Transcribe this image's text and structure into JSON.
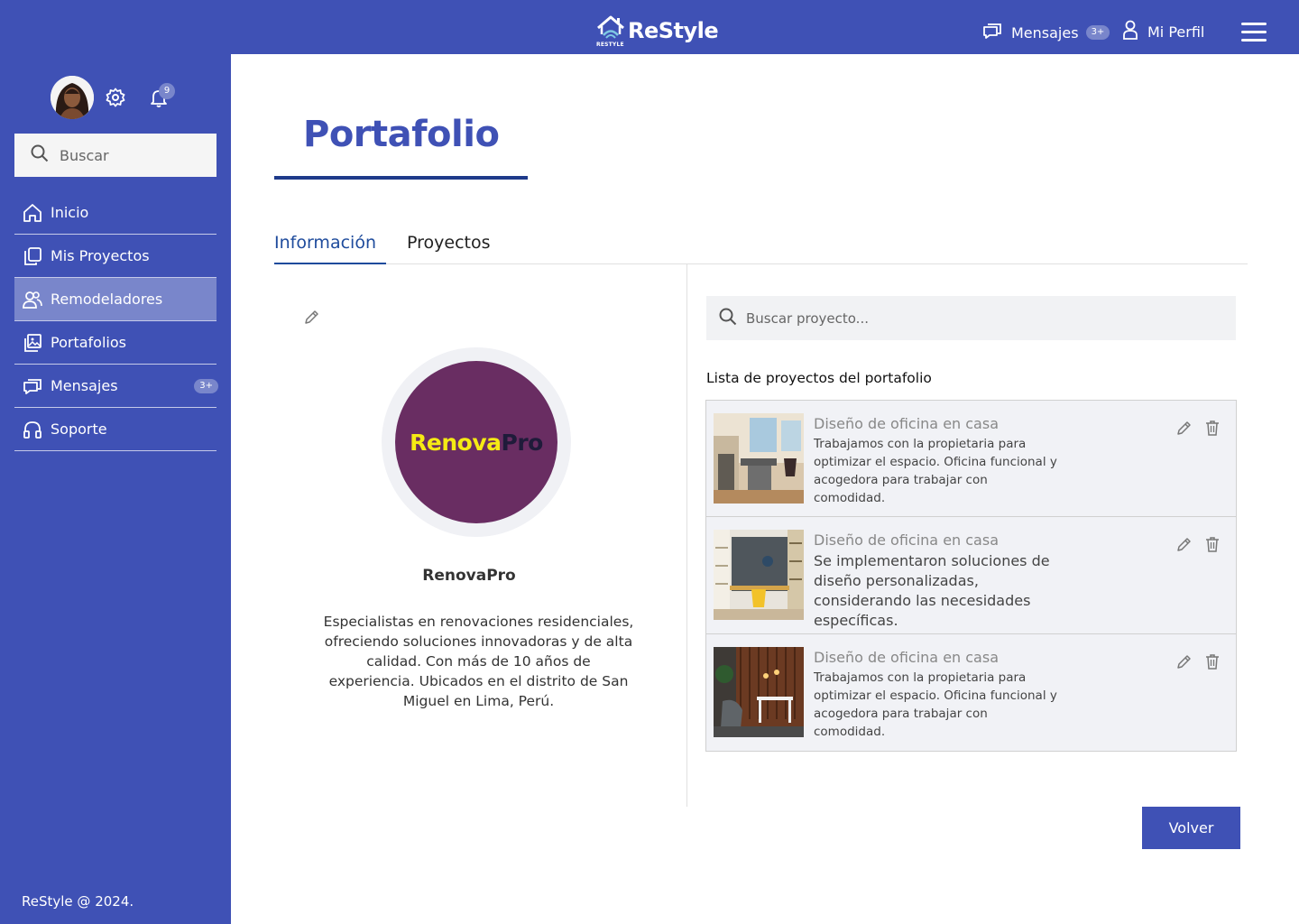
{
  "header": {
    "logo_text": "ReStyle",
    "logo_sub": "RESTYLE",
    "messages_label": "Mensajes",
    "messages_badge": "3+",
    "profile_label": "Mi Perfil",
    "menu_icon": "hamburger-icon"
  },
  "sidebar": {
    "notification_count": "9",
    "search_placeholder": "Buscar",
    "items": [
      {
        "label": "Inicio",
        "icon": "home-icon",
        "active": false
      },
      {
        "label": "Mis Proyectos",
        "icon": "copy-icon",
        "active": false
      },
      {
        "label": "Remodeladores",
        "icon": "users-icon",
        "active": true
      },
      {
        "label": "Portafolios",
        "icon": "gallery-icon",
        "active": false
      },
      {
        "label": "Mensajes",
        "icon": "chat-icon",
        "active": false,
        "badge": "3+"
      },
      {
        "label": "Soporte",
        "icon": "headphones-icon",
        "active": false
      }
    ],
    "footer": "ReStyle @ 2024."
  },
  "page": {
    "title": "Portafolio",
    "tabs": [
      "Información",
      "Proyectos"
    ],
    "active_tab": "Información"
  },
  "company": {
    "logo_part1": "Renova",
    "logo_part2": "Pro",
    "name": "RenovaPro",
    "description": "Especialistas en renovaciones residenciales, ofreciendo soluciones innovadoras y de alta calidad. Con más de 10 años de experiencia. Ubicados en el distrito de San Miguel en Lima, Perú."
  },
  "projects": {
    "search_placeholder": "Buscar proyecto...",
    "list_title": "Lista de proyectos del portafolio",
    "items": [
      {
        "title": "Diseño de oficina en casa",
        "description": "Trabajamos con la propietaria para optimizar el espacio. Oficina funcional y acogedora para trabajar con comodidad."
      },
      {
        "title": "Diseño de oficina en casa",
        "description": "Se implementaron soluciones de diseño personalizadas, considerando las necesidades específicas."
      },
      {
        "title": "Diseño de oficina en casa",
        "description": "Trabajamos con la propietaria para optimizar el espacio. Oficina funcional y acogedora para trabajar con comodidad."
      }
    ]
  },
  "actions": {
    "back_label": "Volver"
  },
  "colors": {
    "primary": "#3f51b5",
    "accent": "#7986cb",
    "title": "#3f51b5",
    "tab_active": "#1e4b9c",
    "logo_bg": "#692d62",
    "logo_yellow": "#f5ea14",
    "logo_dark": "#1f1b3a"
  }
}
